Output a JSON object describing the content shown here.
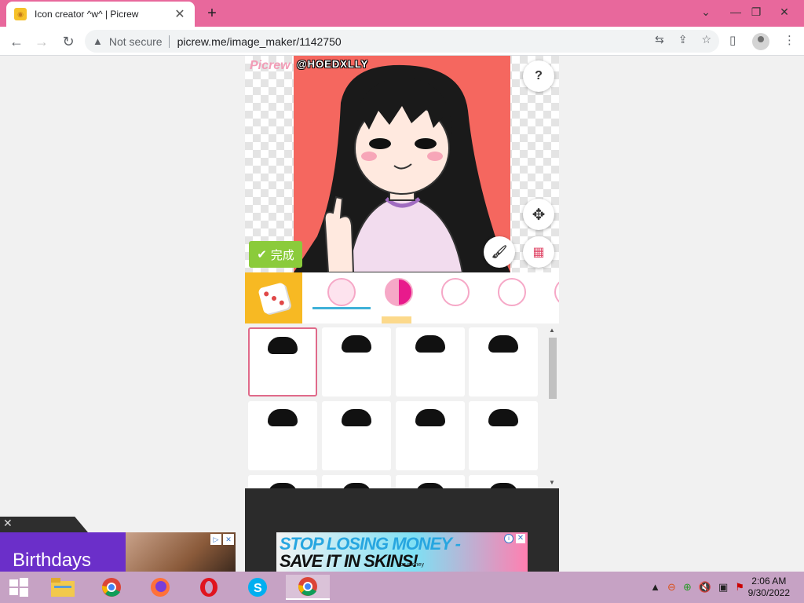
{
  "browser": {
    "tab_title": "Icon creator ^w^ | Picrew",
    "tab_close": "✕",
    "new_tab": "+",
    "not_secure": "Not secure",
    "url": "picrew.me/image_maker/1142750"
  },
  "picrew": {
    "logo": "Picrew",
    "watermark": "@HOEDXLLY",
    "help_label": "?",
    "done_label": "完成",
    "colors": {
      "portrait_bg": "#f5675f",
      "done_button": "#8bcb3b",
      "dice_bg": "#f7b923",
      "selected_border": "#e06a8a",
      "tab_underline": "#3fb1d8"
    }
  },
  "ads": {
    "left_text": "Birthdays",
    "banner_line1": "STOP LOSING MONEY -",
    "banner_line2": "SAVE IT IN SKINS!",
    "banner_brand": "cs money"
  },
  "taskbar": {
    "time": "2:06 AM",
    "date": "9/30/2022"
  }
}
